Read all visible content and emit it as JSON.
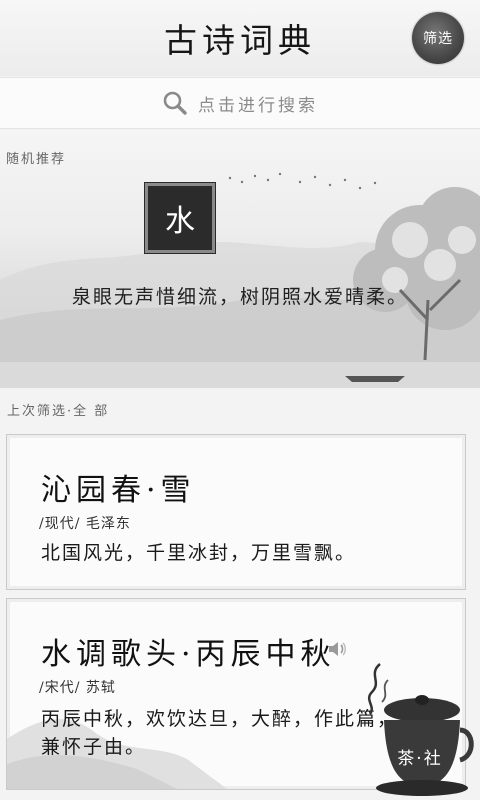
{
  "header": {
    "title": "古诗词典",
    "filter_label": "筛选"
  },
  "search": {
    "placeholder": "点击进行搜索"
  },
  "recommend": {
    "section_label": "随机推荐",
    "character": "水",
    "line": "泉眼无声惜细流，树阴照水爱晴柔。"
  },
  "filter_status": "上次筛选·全 部",
  "poems": [
    {
      "title": "沁园春·雪",
      "meta": "/现代/ 毛泽东",
      "text": "北国风光，千里冰封，万里雪飘。"
    },
    {
      "title": "水调歌头·丙辰中秋",
      "meta": "/宋代/ 苏轼",
      "text": "丙辰中秋，欢饮达旦，大醉，作此篇，兼怀子由。"
    }
  ],
  "badge": {
    "label": "茶·社"
  },
  "icons": [
    "search-icon",
    "speaker-icon",
    "teapot-icon"
  ]
}
